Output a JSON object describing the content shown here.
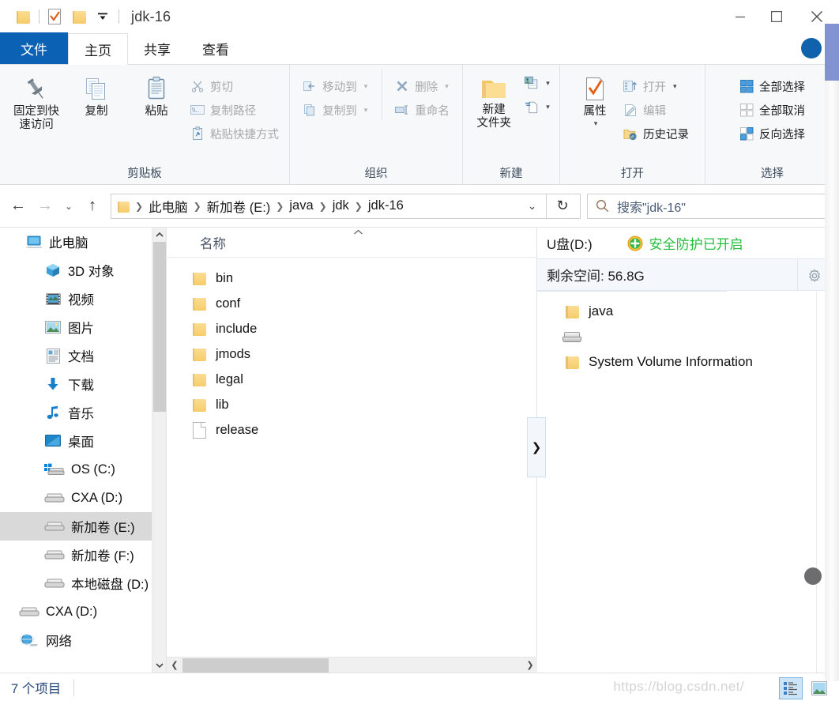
{
  "window": {
    "title": "jdk-16",
    "quick_access": [
      {
        "name": "folder-icon",
        "label": "属性"
      },
      {
        "name": "properties-icon",
        "label": "属性"
      },
      {
        "name": "new-folder-icon",
        "label": "新建文件夹"
      },
      {
        "name": "chevron-down-icon",
        "label": "自定义快速访问工具栏"
      }
    ],
    "controls": {
      "minimize": "—",
      "maximize": "□",
      "close": "✕"
    }
  },
  "ribbon": {
    "tabs": [
      {
        "label": "文件",
        "type": "file"
      },
      {
        "label": "主页",
        "active": true
      },
      {
        "label": "共享",
        "active": false
      },
      {
        "label": "查看",
        "active": false
      }
    ],
    "collapse_icon": "^",
    "groups": [
      {
        "title": "剪贴板",
        "big_buttons": [
          {
            "label": "固定到快\n速访问",
            "icon": "pin-icon"
          },
          {
            "label": "复制",
            "icon": "copy-icon"
          },
          {
            "label": "粘贴",
            "icon": "paste-icon"
          }
        ],
        "small_buttons": [
          {
            "label": "剪切",
            "icon": "scissors-icon",
            "disabled": true
          },
          {
            "label": "复制路径",
            "icon": "copy-path-icon",
            "disabled": true
          },
          {
            "label": "粘贴快捷方式",
            "icon": "paste-shortcut-icon",
            "disabled": true
          }
        ]
      },
      {
        "title": "组织",
        "small_buttons": [
          {
            "label": "移动到",
            "icon": "move-to-icon",
            "caret": true,
            "disabled": true
          },
          {
            "label": "复制到",
            "icon": "copy-to-icon",
            "caret": true,
            "disabled": true
          },
          {
            "label": "删除",
            "icon": "delete-x-icon",
            "caret": true,
            "disabled": true
          },
          {
            "label": "重命名",
            "icon": "rename-icon",
            "disabled": true
          }
        ]
      },
      {
        "title": "新建",
        "big_buttons": [
          {
            "label": "新建\n文件夹",
            "icon": "new-folder-icon"
          }
        ],
        "small_buttons": [
          {
            "label": "",
            "icon": "new-item-icon",
            "caret": true
          },
          {
            "label": "",
            "icon": "easy-access-icon",
            "caret": true
          }
        ]
      },
      {
        "title": "打开",
        "big_buttons": [
          {
            "label": "属性",
            "icon": "properties-icon",
            "caret": true
          }
        ],
        "small_buttons": [
          {
            "label": "打开",
            "icon": "open-icon",
            "caret": true,
            "disabled": true
          },
          {
            "label": "编辑",
            "icon": "edit-icon",
            "disabled": true
          },
          {
            "label": "历史记录",
            "icon": "history-icon"
          }
        ]
      },
      {
        "title": "选择",
        "small_buttons": [
          {
            "label": "全部选择",
            "icon": "select-all-icon"
          },
          {
            "label": "全部取消",
            "icon": "select-none-icon"
          },
          {
            "label": "反向选择",
            "icon": "invert-selection-icon"
          }
        ]
      }
    ]
  },
  "navbar": {
    "back_icon": "←",
    "forward_icon": "→",
    "recent_icon": "⌄",
    "up_icon": "↑",
    "breadcrumbs": [
      "此电脑",
      "新加卷 (E:)",
      "java",
      "jdk",
      "jdk-16"
    ],
    "dropdown_icon": "⌄",
    "refresh_icon": "↻",
    "search_placeholder": "搜索\"jdk-16\"",
    "search_value": ""
  },
  "sidebar": {
    "items": [
      {
        "label": "此电脑",
        "icon": "this-pc-icon",
        "level": 0
      },
      {
        "label": "3D 对象",
        "icon": "3d-objects-icon",
        "level": 1
      },
      {
        "label": "视频",
        "icon": "videos-icon",
        "level": 1
      },
      {
        "label": "图片",
        "icon": "pictures-icon",
        "level": 1
      },
      {
        "label": "文档",
        "icon": "documents-icon",
        "level": 1
      },
      {
        "label": "下载",
        "icon": "downloads-icon",
        "level": 1
      },
      {
        "label": "音乐",
        "icon": "music-icon",
        "level": 1
      },
      {
        "label": "桌面",
        "icon": "desktop-icon",
        "level": 1
      },
      {
        "label": "OS (C:)",
        "icon": "windows-drive-icon",
        "level": 1
      },
      {
        "label": "CXA (D:)",
        "icon": "drive-icon",
        "level": 1
      },
      {
        "label": "新加卷 (E:)",
        "icon": "drive-icon",
        "level": 1,
        "selected": true
      },
      {
        "label": "新加卷 (F:)",
        "icon": "drive-icon",
        "level": 1
      },
      {
        "label": "本地磁盘  (D:)",
        "icon": "drive-icon",
        "level": 1
      },
      {
        "label": "CXA (D:)",
        "icon": "drive-icon",
        "level": 0
      },
      {
        "label": "网络",
        "icon": "network-icon",
        "level": 0
      }
    ],
    "scroll_up_icon": "⌃",
    "scroll_down_icon": "⌄"
  },
  "filelist": {
    "column_header": "名称",
    "sort_indicator": "⌃",
    "rows": [
      {
        "name": "bin",
        "type": "folder"
      },
      {
        "name": "conf",
        "type": "folder"
      },
      {
        "name": "include",
        "type": "folder"
      },
      {
        "name": "jmods",
        "type": "folder"
      },
      {
        "name": "legal",
        "type": "folder"
      },
      {
        "name": "lib",
        "type": "folder"
      },
      {
        "name": "release",
        "type": "file"
      }
    ],
    "expander_icon": "❯",
    "hscroll_left_icon": "❮",
    "hscroll_right_icon": "❯"
  },
  "usb_panel": {
    "drive_name": "U盘(D:)",
    "security_label": "安全防护已开启",
    "security_color": "#25c03c",
    "free_space_label": "剩余空间: 56.8G",
    "settings_icon": "gear-icon",
    "items": [
      {
        "name": "java",
        "type": "folder"
      },
      {
        "name": "",
        "type": "drive"
      },
      {
        "name": "System Volume Information",
        "type": "folder"
      }
    ]
  },
  "statusbar": {
    "item_count": "7 个项目",
    "watermark": "https://blog.csdn.net/",
    "views": [
      {
        "name": "details-view-button",
        "active": true
      },
      {
        "name": "large-icons-view-button",
        "active": false
      }
    ]
  }
}
